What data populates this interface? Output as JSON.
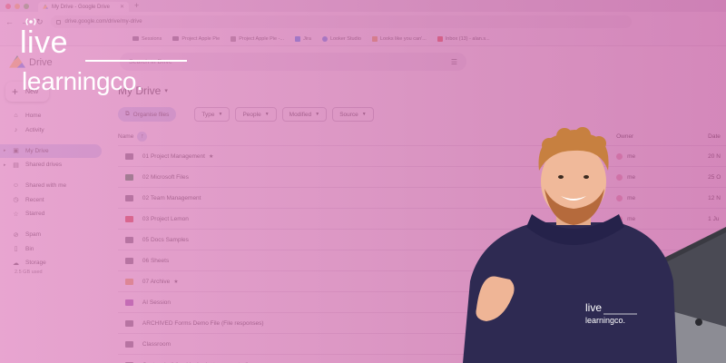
{
  "browser": {
    "tab_title": "My Drive - Google Drive",
    "url": "drive.google.com/drive/my-drive",
    "bookmarks": [
      {
        "label": "Sessions",
        "icon": "folder-icon"
      },
      {
        "label": "Project Apple Pie",
        "icon": "folder-icon"
      },
      {
        "label": "Project Apple Pie -...",
        "icon": "doc-icon"
      },
      {
        "label": "Jira",
        "icon": "jira-icon"
      },
      {
        "label": "Looker Studio",
        "icon": "looker-icon"
      },
      {
        "label": "Looks like you can'...",
        "icon": "page-icon"
      },
      {
        "label": "Inbox (13) - alan.s...",
        "icon": "gmail-icon"
      }
    ]
  },
  "drive": {
    "app_name": "Drive",
    "search_placeholder": "Search in Drive",
    "new_label": "New",
    "page_title": "My Drive"
  },
  "sidebar": {
    "items": [
      {
        "label": "Home",
        "icon": "home-icon"
      },
      {
        "label": "Activity",
        "icon": "bell-icon"
      },
      {
        "label": "My Drive",
        "icon": "my-drive-icon"
      },
      {
        "label": "Shared drives",
        "icon": "shared-drives-icon"
      },
      {
        "label": "Shared with me",
        "icon": "people-icon"
      },
      {
        "label": "Recent",
        "icon": "clock-icon"
      },
      {
        "label": "Starred",
        "icon": "star-icon"
      },
      {
        "label": "Spam",
        "icon": "spam-icon"
      },
      {
        "label": "Bin",
        "icon": "bin-icon"
      },
      {
        "label": "Storage",
        "icon": "cloud-icon"
      }
    ],
    "storage_used": "2.5 GB used"
  },
  "filters": {
    "organise": "Organise files",
    "type": "Type",
    "people": "People",
    "modified": "Modified",
    "source": "Source"
  },
  "columns": {
    "name": "Name",
    "owner": "Owner",
    "date": "Date"
  },
  "files": [
    {
      "name": "01 Project Management",
      "owner": "me",
      "date": "20 N",
      "color": "#5f6368",
      "starred": true
    },
    {
      "name": "02 Microsoft Files",
      "owner": "me",
      "date": "25 O",
      "color": "#188038",
      "starred": false
    },
    {
      "name": "02 Team Management",
      "owner": "me",
      "date": "12 N",
      "color": "#5f6368",
      "starred": false
    },
    {
      "name": "03 Project Lemon",
      "owner": "me",
      "date": "1 Ju",
      "color": "#d93025",
      "starred": false
    },
    {
      "name": "05 Docs Samples",
      "owner": "me",
      "date": "12 N",
      "color": "#5f6368",
      "starred": false
    },
    {
      "name": "06 Sheets",
      "owner": "",
      "date": "",
      "color": "#5f6368",
      "starred": false
    },
    {
      "name": "07 Archive",
      "owner": "",
      "date": "",
      "color": "#e8a33c",
      "starred": true
    },
    {
      "name": "AI Session",
      "owner": "",
      "date": "",
      "color": "#8e44ad",
      "starred": false
    },
    {
      "name": "ARCHIVED Forms Demo File (File responses)",
      "owner": "",
      "date": "",
      "color": "#5f6368",
      "starred": false
    },
    {
      "name": "Classroom",
      "owner": "",
      "date": "",
      "color": "#5f6368",
      "starred": false
    },
    {
      "name": "Custom building blocks (auto-generated)",
      "owner": "",
      "date": "",
      "color": "#5f6368",
      "starred": false
    }
  ],
  "brand": {
    "line1": "live",
    "line2": "learningco."
  },
  "hoodie": {
    "line1": "live",
    "line2": "learningco."
  },
  "colors": {
    "overlay": "#d47ab8",
    "accent_blue": "#c2d7f7",
    "hoodie": "#2e2a52"
  }
}
